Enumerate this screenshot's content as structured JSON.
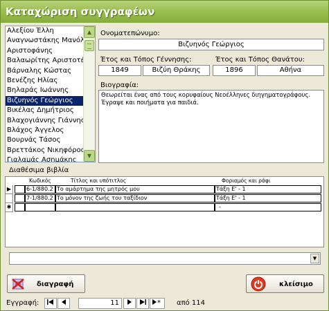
{
  "window": {
    "title": "Καταχώριση συγγραφέων"
  },
  "authors_list": {
    "items": [
      "Αλεξίου Έλλη",
      "Αναγνωστάκης Μανόλης",
      "Αριστοφάνης",
      "Βαλαωρίτης Αριστοτέλης",
      "Βάρναλης Κώστας",
      "Βενέζης Ηλίας",
      "Βηλαράς Ιωάννης",
      "Βιζυηνός Γεώργιος",
      "Βικέλας Δημήτριος",
      "Βλαχογιάννης Γιάννης",
      "Βλάχος Άγγελος",
      "Βουρνάς Τάσος",
      "Βρεττάκος Νικηφόρος",
      "Γιαλαμάς Ασημάκης"
    ],
    "selected_index": 7
  },
  "name": {
    "label": "Ονοματεπώνυμο:",
    "value": "Βιζυηνός Γεώργιος"
  },
  "birth": {
    "label": "Έτος και Τόπος Γέννησης:",
    "year": "1849",
    "place": "Βιζύη Θράκης"
  },
  "death": {
    "label": "Έτος και Τόπος Θανάτου:",
    "year": "1896",
    "place": "Αθήνα"
  },
  "bio": {
    "label": "Βιογραφία:",
    "line1": "Θεωρείται ένας από τους κορυφαίους Νεοέλληνες διηγηματογράφους.",
    "line2": "Έγραψε και ποιήματα για παιδιά."
  },
  "books": {
    "label": "Διαθέσιμα βιβλία",
    "headers": {
      "code": "Κωδικός",
      "title": "Τίτλος και υπότιτλος",
      "shelf": "Φοριαμός και ράφι"
    },
    "rows": [
      {
        "code": "6-1/880.2",
        "title": "Το αμάρτημα της μητρός μου",
        "shelf": "Τάξη Ε' - 1"
      },
      {
        "code": "7-1/880.2",
        "title": "Το μόνον της ζωής του ταξίδιον",
        "shelf": "Τάξη Ε' - 1"
      }
    ],
    "new_row_shelf": "-",
    "current_marker": "▶",
    "new_marker": "✱"
  },
  "combo": {
    "value": ""
  },
  "buttons": {
    "delete": "διαγραφή",
    "close": "κλείσιμο"
  },
  "nav": {
    "label": "Εγγραφή:",
    "current": "11",
    "total_text": "από 114",
    "icons": {
      "first": "first-record-icon",
      "prev": "previous-record-icon",
      "next": "next-record-icon",
      "last": "last-record-icon",
      "new": "new-record-icon"
    }
  },
  "colors": {
    "titlebar": "#9cbf52",
    "selection": "#0a246a",
    "close_icon": "#e03a1e"
  }
}
